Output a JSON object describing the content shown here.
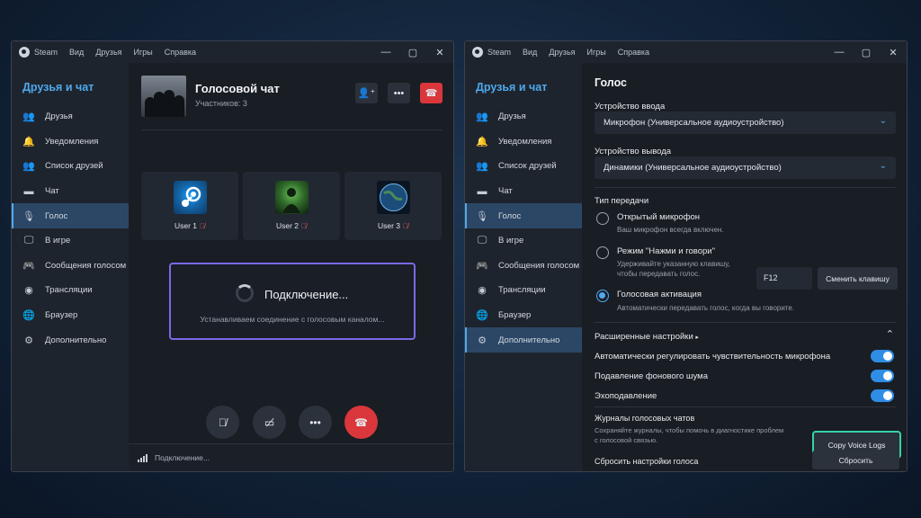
{
  "menubar": {
    "brand": "Steam",
    "items": [
      "Вид",
      "Друзья",
      "Игры",
      "Справка"
    ]
  },
  "sidebar": {
    "title": "Друзья и чат",
    "items": [
      {
        "label": "Друзья",
        "icon": "friends-icon"
      },
      {
        "label": "Уведомления",
        "icon": "bell-icon"
      },
      {
        "label": "Список друзей",
        "icon": "friends-list-icon"
      },
      {
        "label": "Чат",
        "icon": "chat-icon"
      },
      {
        "label": "Голос",
        "icon": "microphone-icon"
      },
      {
        "label": "В игре",
        "icon": "monitor-icon"
      },
      {
        "label": "Сообщения голосом",
        "icon": "gamepad-icon"
      },
      {
        "label": "Трансляции",
        "icon": "broadcast-icon"
      },
      {
        "label": "Браузер",
        "icon": "globe-icon"
      },
      {
        "label": "Дополнительно",
        "icon": "gear-icon"
      }
    ]
  },
  "voice_chat": {
    "title": "Голосовой чат",
    "participants": "Участников: 3",
    "users": [
      {
        "name": "User 1",
        "avatar": "steam-logo-avatar"
      },
      {
        "name": "User 2",
        "avatar": "green-figure-avatar"
      },
      {
        "name": "User 3",
        "avatar": "earth-avatar"
      }
    ],
    "connecting_title": "Подключение...",
    "connecting_sub": "Устанавливаем соединение с голосовым каналом...",
    "status": "Подключение..."
  },
  "settings": {
    "title": "Голос",
    "input_label": "Устройство ввода",
    "input_value": "Микрофон (Универсальное аудиоустройство)",
    "output_label": "Устройство вывода",
    "output_value": "Динамики (Универсальное аудиоустройство)",
    "transmit_label": "Тип передачи",
    "open_mic": "Открытый микрофон",
    "open_mic_sub": "Ваш микрофон всегда включен.",
    "ptt": "Режим \"Нажми и говори\"",
    "ptt_sub1": "Удерживайте указанную клавишу,",
    "ptt_sub2": "чтобы передавать голос.",
    "ptt_key": "F12",
    "change_key": "Сменить клавишу",
    "voice_act": "Голосовая активация",
    "voice_act_sub": "Автоматически передавать голос, когда вы говорите.",
    "selected_mode": "Голосовая активация",
    "advanced": "Расширенные настройки",
    "toggles": [
      {
        "label": "Автоматически регулировать чувствительность микрофона",
        "on": true
      },
      {
        "label": "Подавление фонового шума",
        "on": true
      },
      {
        "label": "Эхоподавление",
        "on": true
      }
    ],
    "logs_label": "Журналы голосовых чатов",
    "logs_sub1": "Сохраняйте журналы, чтобы помочь в диагностике проблем",
    "logs_sub2": "с голосовой связью.",
    "copy_logs": "Copy Voice Logs",
    "reset_label": "Сбросить настройки голоса",
    "reset_btn": "Сбросить"
  },
  "colors": {
    "accent": "#4fa9ee",
    "hangup": "#d9373b",
    "highlight_purple": "#7b69e8",
    "highlight_green": "#34d3a8"
  }
}
